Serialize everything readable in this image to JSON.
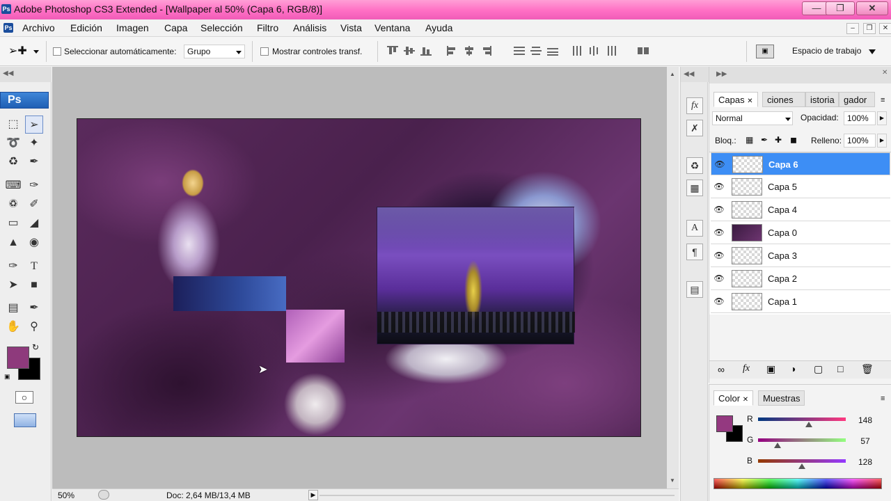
{
  "window": {
    "title": "Adobe Photoshop CS3 Extended - [Wallpaper al 50% (Capa 6, RGB/8)]",
    "app_icon": "Ps",
    "controls": [
      "minimize-icon",
      "maximize-icon",
      "close-icon"
    ]
  },
  "menu": {
    "items": [
      "Archivo",
      "Edición",
      "Imagen",
      "Capa",
      "Selección",
      "Filtro",
      "Análisis",
      "Vista",
      "Ventana",
      "Ayuda"
    ]
  },
  "options": {
    "auto_select_label": "Seleccionar automáticamente:",
    "auto_select_value": "Grupo",
    "show_transform_label": "Mostrar controles transf.",
    "workspace_label": "Espacio de trabajo"
  },
  "tools": {
    "logo": "Ps",
    "foreground_color": "#8e3a7c",
    "background_color": "#000000"
  },
  "status": {
    "zoom": "50%",
    "doc_info": "Doc: 2,64 MB/13,4 MB"
  },
  "layers_panel": {
    "tabs": [
      "Capas",
      "ciones",
      "istoria",
      "gador"
    ],
    "blend_mode": "Normal",
    "opacity_label": "Opacidad:",
    "opacity_value": "100%",
    "lock_label": "Bloq.:",
    "fill_label": "Relleno:",
    "fill_value": "100%",
    "layers": [
      {
        "name": "Capa 6",
        "selected": true
      },
      {
        "name": "Capa 5",
        "selected": false
      },
      {
        "name": "Capa 4",
        "selected": false
      },
      {
        "name": "Capa 0",
        "selected": false
      },
      {
        "name": "Capa 3",
        "selected": false
      },
      {
        "name": "Capa 2",
        "selected": false
      },
      {
        "name": "Capa 1",
        "selected": false
      }
    ]
  },
  "color_panel": {
    "tabs": [
      "Color",
      "Muestras"
    ],
    "r_label": "R",
    "r_value": "148",
    "g_label": "G",
    "g_value": "57",
    "b_label": "B",
    "b_value": "128",
    "swatch_color": "#943980"
  }
}
